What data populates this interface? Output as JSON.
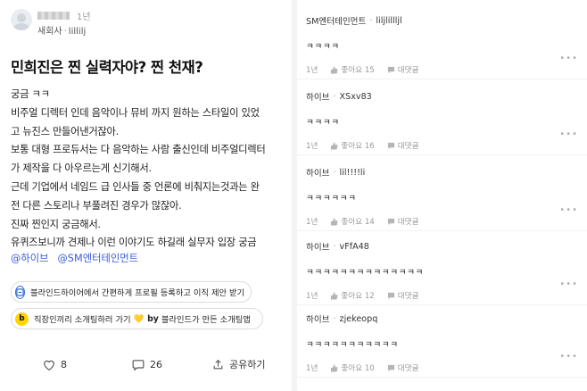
{
  "post": {
    "author_time": "1년",
    "company_line": "새회사",
    "nickname": "lillilj",
    "title": "민희진은 찐 실력자야? 찐 천재?",
    "body": [
      "궁금 ㅋㅋ",
      "비주얼 디렉터 인데 음악이나 뮤비 까지 원하는 스타일이 있었",
      "고 뉴진스 만들어낸거잖아.",
      "보통 대형 프로듀서는 다 음악하는 사람 출신인데 비주얼디렉터",
      "가 제작을 다 아우르는게 신기해서.",
      "근데 기업에서 네임드 급 인사들 중 언론에 비춰지는것과는 완",
      "전 다른 스토리나 부풀려진 경우가 많잖아.",
      "진짜 찐인지 궁금해서.",
      "유퀴즈보니까 견제나 이런 이야기도 하길래 실무자 입장 궁금"
    ],
    "tags": [
      "@하이브",
      "@SM엔터테인먼트"
    ],
    "promo1": "블라인드하이어에서 간편하게 프로필 등록하고 이직 제안 받기",
    "promo2_a": "직장인끼리 소개팅하러 가기",
    "promo2_heart": "💛",
    "promo2_by": "by",
    "promo2_b": "블라인드가 만든 소개팅앱",
    "promo2_badge": "b",
    "likes": "8",
    "comments": "26",
    "share": "공유하기"
  },
  "comments": [
    {
      "company": "SM엔터테인먼트",
      "nick": "liljlillljl",
      "text": "ㅋㅋㅋㅋ",
      "time": "1년",
      "like": "좋아요 15",
      "reply": "대댓글"
    },
    {
      "company": "하이브",
      "nick": "XSxv83",
      "text": "ㅋㅋㅋㅋ",
      "time": "1년",
      "like": "좋아요 16",
      "reply": "대댓글"
    },
    {
      "company": "하이브",
      "nick": "lil!!!!li",
      "text": "ㅋㅋㅋㅋㅋㅋ",
      "time": "1년",
      "like": "좋아요 14",
      "reply": "대댓글"
    },
    {
      "company": "하이브",
      "nick": "vFfA48",
      "text": "ㅋㅋㅋㅋㅋㅋㅋㅋㅋㅋㅋㅋㅋㅋ",
      "time": "1년",
      "like": "좋아요 12",
      "reply": "대댓글"
    },
    {
      "company": "하이브",
      "nick": "zjekeopq",
      "text": "ㅋㅋㅋㅋㅋㅋㅋㅋㅋㅋㅋ",
      "time": "1년",
      "like": "좋아요 10",
      "reply": "대댓글"
    }
  ],
  "colors": {
    "tag": "#3b5bdb",
    "promo_blue": "#2f6fde",
    "promo_yellow": "#ffd400"
  },
  "icons": [
    "heart-icon",
    "comment-icon",
    "share-icon",
    "thumbs-up-icon",
    "reply-icon",
    "more-icon"
  ]
}
